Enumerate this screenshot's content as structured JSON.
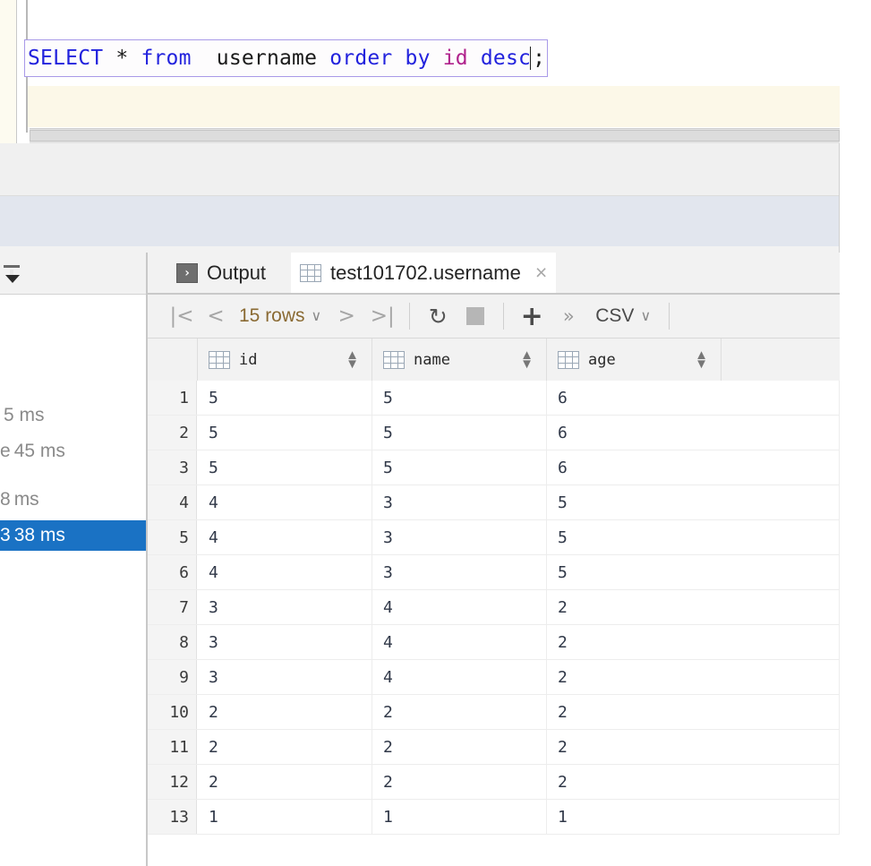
{
  "editor": {
    "sql_tokens": [
      {
        "text": "SELECT",
        "type": "keyword"
      },
      {
        "text": " * ",
        "type": "plain"
      },
      {
        "text": "from",
        "type": "keyword"
      },
      {
        "text": "  ",
        "type": "plain"
      },
      {
        "text": "username",
        "type": "plain"
      },
      {
        "text": " ",
        "type": "plain"
      },
      {
        "text": "order",
        "type": "keyword"
      },
      {
        "text": " ",
        "type": "plain"
      },
      {
        "text": "by",
        "type": "keyword"
      },
      {
        "text": " ",
        "type": "plain"
      },
      {
        "text": "id",
        "type": "column"
      },
      {
        "text": " ",
        "type": "plain"
      },
      {
        "text": "desc",
        "type": "keyword"
      }
    ],
    "sql_text": "SELECT * from  username order by id desc;",
    "statement_terminator": ";",
    "keyword_color": "#2222dd",
    "column_color": "#b0228c",
    "statement_box_border": "#a99ae8",
    "highlight_band_color": "#fcf8e8"
  },
  "left_panel": {
    "filter_icon": "filter-funnel-icon",
    "timings": [
      {
        "lead": "",
        "label": "5 ms",
        "selected": false
      },
      {
        "lead": "e",
        "label": "45 ms",
        "selected": false
      },
      {
        "lead": "8",
        "label": "ms",
        "selected": false
      },
      {
        "lead": "3",
        "label": "38 ms",
        "selected": true
      }
    ],
    "selected_color": "#1a72c4"
  },
  "results": {
    "tabs": [
      {
        "label": "Output",
        "icon": "console-output-icon",
        "active": false,
        "closable": false
      },
      {
        "label": "test101702.username",
        "icon": "table-grid-icon",
        "active": true,
        "closable": true
      }
    ],
    "close_glyph": "×",
    "toolbar": {
      "first_page": "|<",
      "prev_page": "<",
      "rows_label": "15 rows",
      "rows_caret": "∨",
      "next_page": ">",
      "last_page": ">|",
      "refresh": "↻",
      "stop": "stop-square-icon",
      "add_row": "+",
      "more": "»",
      "export_format": "CSV",
      "export_caret": "∨"
    },
    "grid": {
      "columns": [
        {
          "name": "id",
          "icon": "column-table-icon",
          "sortable": true
        },
        {
          "name": "name",
          "icon": "column-table-icon",
          "sortable": true
        },
        {
          "name": "age",
          "icon": "column-table-icon",
          "sortable": true
        }
      ],
      "sort_glyph_up": "▲",
      "sort_glyph_down": "▼",
      "rows": [
        {
          "n": "1",
          "id": "5",
          "name": "5",
          "age": "6"
        },
        {
          "n": "2",
          "id": "5",
          "name": "5",
          "age": "6"
        },
        {
          "n": "3",
          "id": "5",
          "name": "5",
          "age": "6"
        },
        {
          "n": "4",
          "id": "4",
          "name": "3",
          "age": "5"
        },
        {
          "n": "5",
          "id": "4",
          "name": "3",
          "age": "5"
        },
        {
          "n": "6",
          "id": "4",
          "name": "3",
          "age": "5"
        },
        {
          "n": "7",
          "id": "3",
          "name": "4",
          "age": "2"
        },
        {
          "n": "8",
          "id": "3",
          "name": "4",
          "age": "2"
        },
        {
          "n": "9",
          "id": "3",
          "name": "4",
          "age": "2"
        },
        {
          "n": "10",
          "id": "2",
          "name": "2",
          "age": "2"
        },
        {
          "n": "11",
          "id": "2",
          "name": "2",
          "age": "2"
        },
        {
          "n": "12",
          "id": "2",
          "name": "2",
          "age": "2"
        },
        {
          "n": "13",
          "id": "1",
          "name": "1",
          "age": "1"
        }
      ]
    }
  }
}
